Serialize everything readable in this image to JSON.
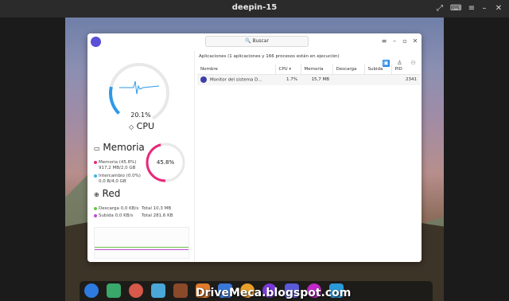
{
  "vm": {
    "title": "deepin-15"
  },
  "app": {
    "search_placeholder": "Buscar",
    "cpu": {
      "percent": "20.1%",
      "label": "CPU",
      "value": 0.201
    },
    "memory": {
      "title": "Memoria",
      "percent": "45.8%",
      "value": 0.458,
      "mem_line1": "Memoria (45.8%)",
      "mem_line2": "917,2 MB/2,0 GB",
      "swap_line1": "Intercambio (0.0%)",
      "swap_line2": "0,0 B/4,0 GB"
    },
    "network": {
      "title": "Red",
      "download": "Descarga 0,0 KB/s",
      "download_total": "Total 10,3 MB",
      "upload": "Subida 0,0 KB/s",
      "upload_total": "Total 281,6 KB"
    },
    "summary": "Aplicaciones (1 aplicaciones y 166 procesos están en ejecución)",
    "columns": [
      "Nombre",
      "CPU",
      "Memoria",
      "Descarga",
      "Subida",
      "PID"
    ],
    "rows": [
      {
        "name": "Monitor del sistema D...",
        "cpu": "1.7%",
        "memory": "15,7 MB",
        "download": "",
        "upload": "",
        "pid": "2341"
      }
    ]
  },
  "watermark": "DriveMeca.blogspot.com",
  "colors": {
    "cpu": "#2c9ae8",
    "memory": "#e8287a",
    "swap": "#3bb4e8",
    "download": "#6ac24a",
    "upload": "#c04ad8"
  }
}
